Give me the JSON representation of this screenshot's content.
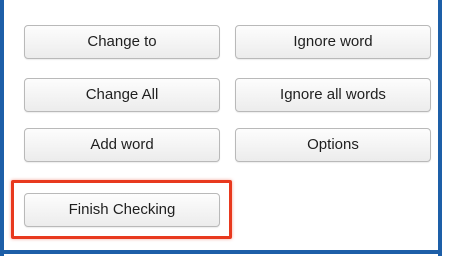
{
  "buttons": {
    "change_to": "Change to",
    "ignore_word": "Ignore word",
    "change_all": "Change All",
    "ignore_all_words": "Ignore all words",
    "add_word": "Add word",
    "options": "Options",
    "finish_checking": "Finish Checking"
  },
  "colors": {
    "frame": "#1d5fa8",
    "highlight": "#e8391e"
  }
}
